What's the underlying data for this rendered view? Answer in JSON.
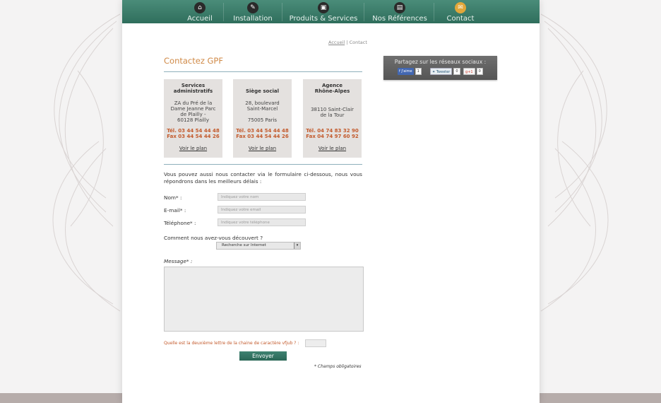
{
  "nav": [
    {
      "label": "Accueil",
      "icon": "home-icon",
      "glyph": "⌂"
    },
    {
      "label": "Installation",
      "icon": "wrench-icon",
      "glyph": "✎"
    },
    {
      "label": "Produits & Services",
      "icon": "briefcase-icon",
      "glyph": "▣"
    },
    {
      "label": "Nos Références",
      "icon": "document-icon",
      "glyph": "▤"
    },
    {
      "label": "Contact",
      "icon": "mail-icon",
      "glyph": "✉"
    }
  ],
  "breadcrumb": {
    "home": "Accueil",
    "sep": "|",
    "current": "Contact"
  },
  "page_title": "Contactez GPF",
  "cards": [
    {
      "title_line1": "Services",
      "title_line2": "administratifs",
      "addr_line1": "ZA du Pré de la",
      "addr_line2": "Dame Jeanne Parc",
      "addr_line3": "de Plailly -",
      "addr_line4": "60128 Plailly",
      "tel": "Tél. 03 44 54 44 48",
      "fax": "Fax 03 44 54 44 26",
      "link": "Voir le plan"
    },
    {
      "title_line1": "Siège social",
      "addr_line1": "28, boulevard",
      "addr_line2": "Saint-Marcel",
      "addr_line3": "75005 Paris",
      "tel": "Tél. 03 44 54 44 48",
      "fax": "Fax 03 44 54 44 26",
      "link": "Voir le plan"
    },
    {
      "title_line1": "Agence",
      "title_line2": "Rhône-Alpes",
      "addr_line1": "38110 Saint-Clair",
      "addr_line2": "de la Tour",
      "tel": "Tél. 04 74 83 32 90",
      "fax": "Fax 04 74 97 60 92",
      "link": "Voir le plan"
    }
  ],
  "intro": "Vous pouvez aussi nous contacter via le formulaire ci-dessous, nous vous répondrons dans les meilleurs délais :",
  "form": {
    "name_label": "Nom* :",
    "name_placeholder": "Indiquez votre nom",
    "email_label": "E-mail* :",
    "email_placeholder": "Indiquez votre email",
    "phone_label": "Téléphone* :",
    "phone_placeholder": "Indiquez votre téléphone",
    "source_label": "Comment nous avez-vous découvert ?",
    "source_selected": "Recherche sur Internet",
    "message_label": "Message* :",
    "captcha_label": "Quelle est la deuxième lettre de la chaine de caractère vfjub ? :",
    "submit_label": "Envoyer",
    "required_note": "* Champs obligatoires"
  },
  "share": {
    "title": "Partagez sur les réseaux sociaux :",
    "facebook_label": "J'aime",
    "facebook_count": "1",
    "twitter_label": "Tweeter",
    "twitter_count": "0",
    "gplus_label": "+1",
    "gplus_count": "0"
  },
  "colors": {
    "nav_green": "#3e7f6d",
    "accent_orange": "#d08a47",
    "phone_red": "#c35a2c",
    "active_icon": "#e1a73a",
    "card_bg": "#e4e1df"
  }
}
